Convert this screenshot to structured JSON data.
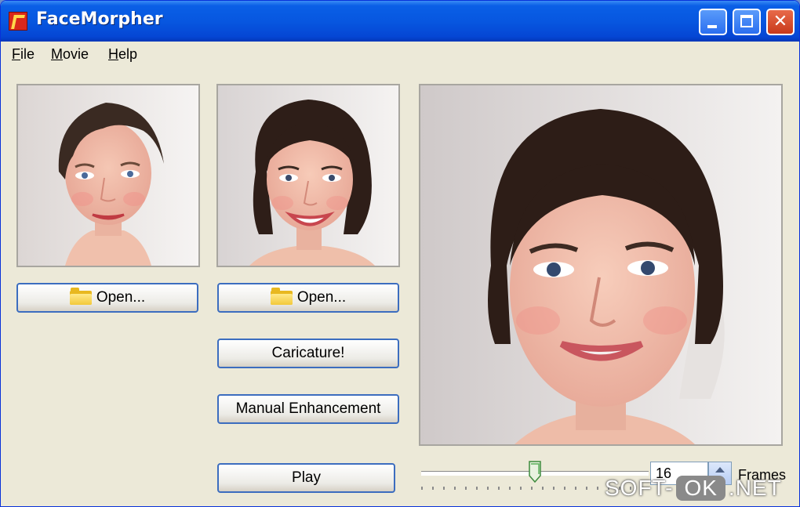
{
  "window": {
    "title": "FaceMorpher"
  },
  "menu": [
    "File",
    "Movie",
    "Help"
  ],
  "buttons": {
    "open_left": "Open...",
    "open_right": "Open...",
    "caricature": "Caricature!",
    "manual": "Manual Enhancement",
    "play": "Play"
  },
  "frames": {
    "value": "16",
    "label": "Frames",
    "slider_position": 0.5
  },
  "watermark": {
    "left": "SOFT-",
    "box": "OK",
    "right": ".NET"
  },
  "colors": {
    "title_bar": "#0757e0",
    "window_bg": "#ece9d8",
    "button_border": "#3c6dbf",
    "close_button": "#c8391a"
  },
  "icons": [
    "app-icon",
    "folder-icon",
    "minimize-icon",
    "maximize-icon",
    "close-icon",
    "spin-up-icon"
  ]
}
